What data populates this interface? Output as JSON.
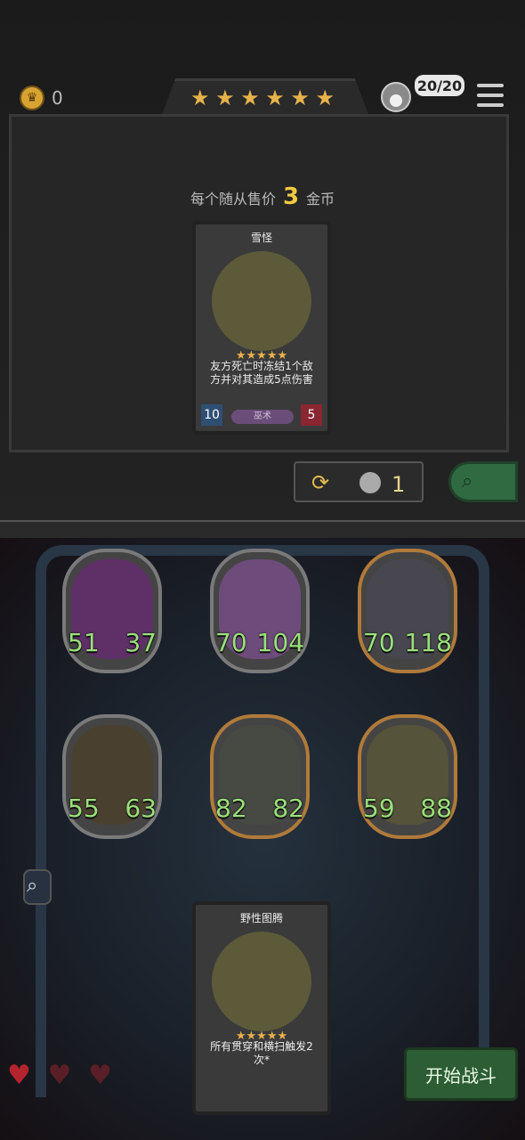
{
  "top": {
    "coin_count": "0",
    "stars": [
      "★",
      "★",
      "★",
      "★",
      "★",
      "★"
    ],
    "player_capacity": "20/20"
  },
  "shop": {
    "price_prefix": "每个随从售价",
    "price_value": "3",
    "price_suffix": "金币",
    "card": {
      "name": "雪怪",
      "stars": "★★★★★",
      "description": "友方死亡时冻结1个敌方并对其造成5点伤害",
      "attack": "10",
      "health": "5",
      "tag": "巫术"
    },
    "refresh_cost": "1"
  },
  "board": {
    "minions": [
      {
        "name": "minion-1",
        "attack": "51",
        "health": "37",
        "color": "#5f2f68",
        "frame": "#7a7a7a"
      },
      {
        "name": "minion-2",
        "attack": "70",
        "health": "104",
        "color": "#6d4b7a",
        "frame": "#7a7a7a"
      },
      {
        "name": "minion-3",
        "attack": "70",
        "health": "118",
        "color": "#484750",
        "frame": "#b07a3a"
      },
      {
        "name": "minion-4",
        "attack": "55",
        "health": "63",
        "color": "#4a4030",
        "frame": "#7a7a7a"
      },
      {
        "name": "minion-5",
        "attack": "82",
        "health": "82",
        "color": "#474a43",
        "frame": "#b07a3a"
      },
      {
        "name": "minion-6",
        "attack": "59",
        "health": "88",
        "color": "#55533a",
        "frame": "#b07a3a"
      }
    ]
  },
  "hand_card": {
    "name": "野性图腾",
    "stars": "★★★★★",
    "description": "所有贯穿和横扫触发2次*"
  },
  "lives": [
    "♥",
    "♥",
    "♥"
  ],
  "start_button": "开始战斗"
}
